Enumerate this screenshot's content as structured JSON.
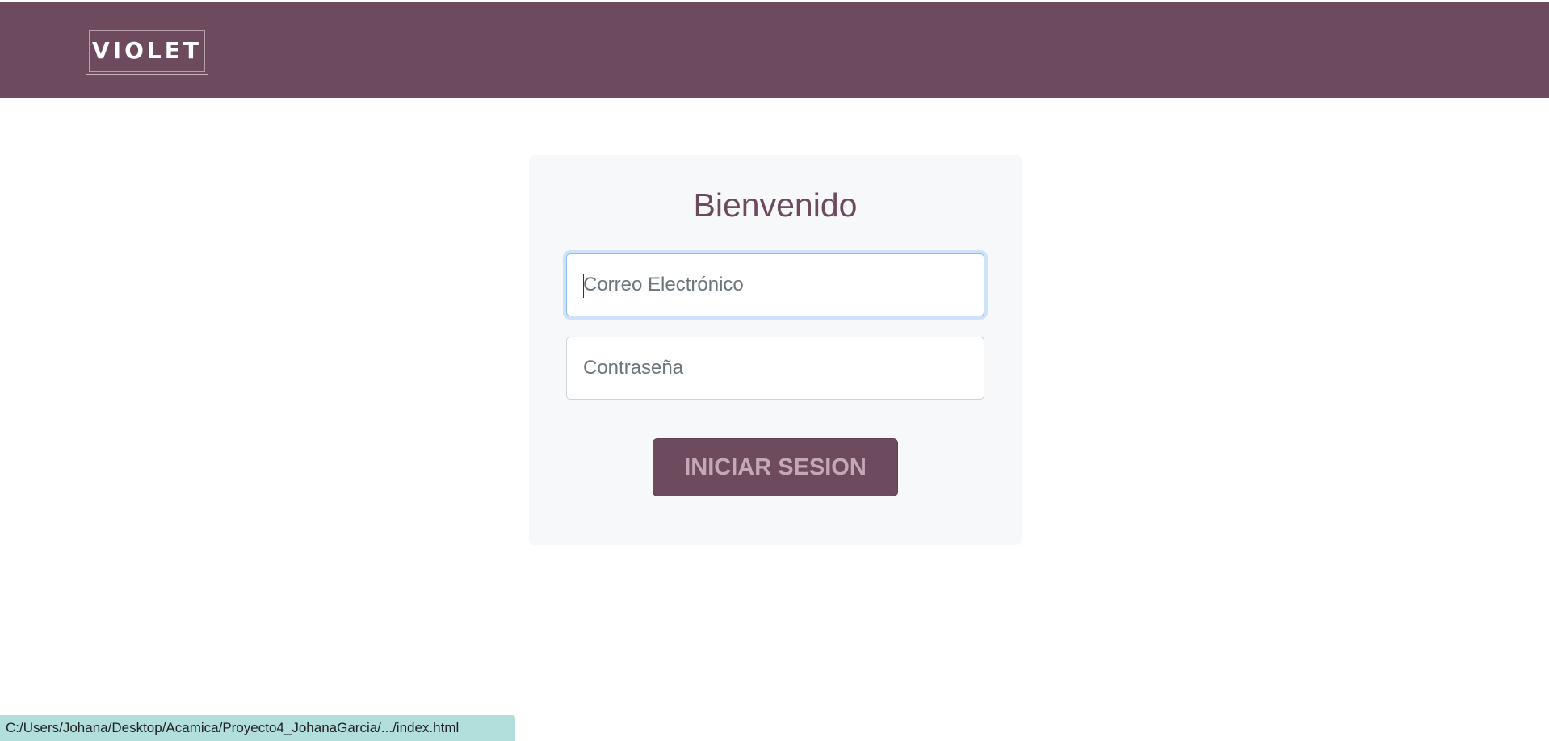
{
  "header": {
    "logo_text": "VIOLET",
    "background_color": "#6e4a5f"
  },
  "login_card": {
    "title": "Bienvenido",
    "email_placeholder": "Correo Electrónico",
    "email_value": "",
    "password_placeholder": "Contraseña",
    "password_value": "",
    "submit_label": "INICIAR SESION"
  },
  "status_bar": {
    "url": "C:/Users/Johana/Desktop/Acamica/Proyecto4_JohanaGarcia/.../index.html"
  },
  "colors": {
    "accent": "#6e4a5f",
    "focus_ring": "#8cbcf2",
    "status_bar_bg": "#b2dfdb"
  }
}
